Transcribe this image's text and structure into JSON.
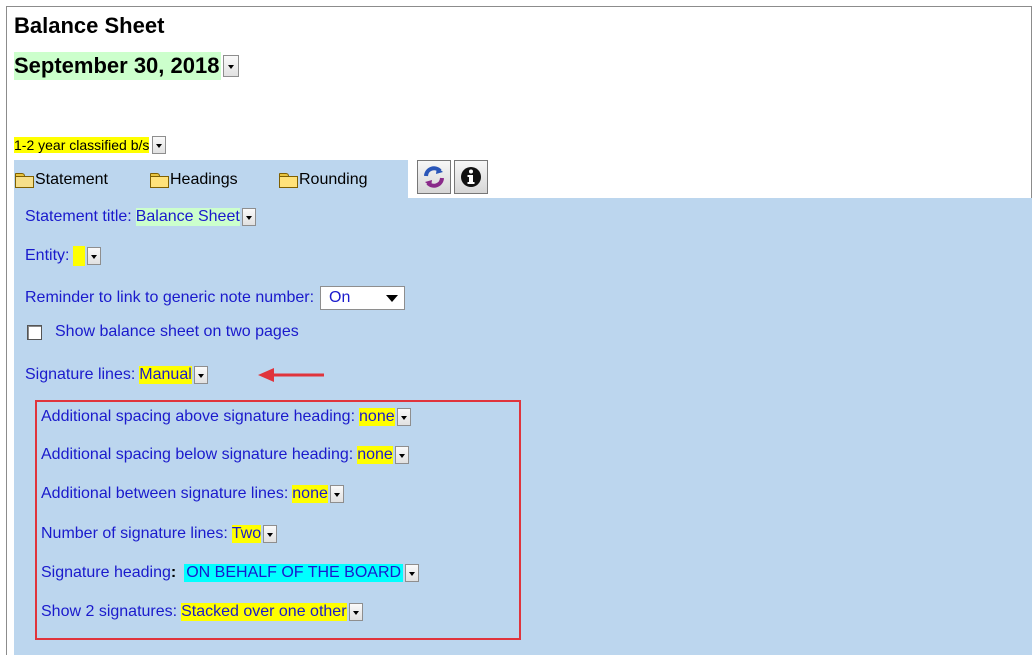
{
  "header": {
    "title": "Balance Sheet",
    "date": "September 30, 2018",
    "classification": "1-2 year classified b/s"
  },
  "tabs": [
    {
      "label": "Statement",
      "icon": "folder-open-icon"
    },
    {
      "label": "Headings",
      "icon": "folder-icon"
    },
    {
      "label": "Rounding",
      "icon": "folder-icon"
    }
  ],
  "toolbar": {
    "refresh_icon": "refresh-icon",
    "info_icon": "info-icon"
  },
  "settings": {
    "statement_title_label": "Statement title:",
    "statement_title_value": "Balance Sheet",
    "entity_label": "Entity:",
    "entity_value": "",
    "reminder_label": "Reminder to link to generic note number:",
    "reminder_value": "On",
    "two_pages_label": "Show balance sheet on two pages",
    "two_pages_checked": false,
    "signature_lines_label": "Signature lines:",
    "signature_lines_value": "Manual"
  },
  "signature_options": {
    "spacing_above_label": "Additional spacing above signature heading:",
    "spacing_above_value": "none",
    "spacing_below_label": "Additional spacing below signature heading:",
    "spacing_below_value": "none",
    "between_lines_label": "Additional between signature lines:",
    "between_lines_value": "none",
    "number_lines_label": "Number of signature lines:",
    "number_lines_value": "Two",
    "heading_label": "Signature heading",
    "heading_colon": ":",
    "heading_value": "ON BEHALF OF THE BOARD",
    "show_two_label": "Show 2 signatures:",
    "show_two_value": "Stacked over one other"
  },
  "colors": {
    "panel": "#bcd6ee",
    "label_text": "#1a1acc",
    "highlight_yellow": "#ffff00",
    "highlight_cyan": "#00ffff",
    "highlight_green": "#ccffcc",
    "annotation_red": "#e0343c"
  }
}
